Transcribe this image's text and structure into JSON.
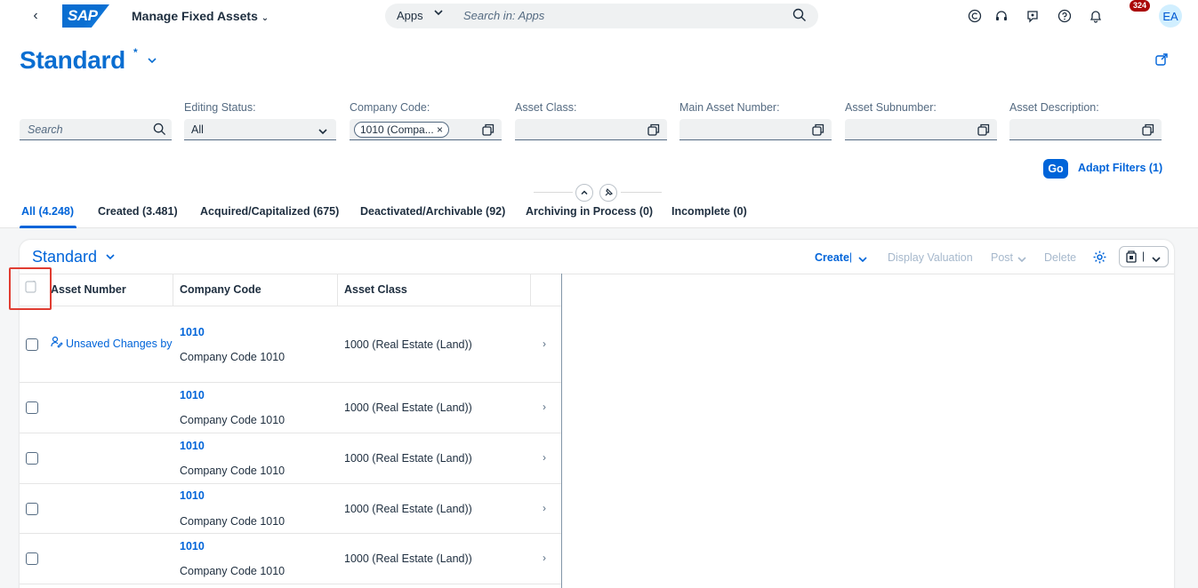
{
  "shell": {
    "logo_text": "SAP",
    "app_title": "Manage Fixed Assets",
    "search_scope": "Apps",
    "search_placeholder": "Search in: Apps",
    "notification_count": "324",
    "avatar_initials": "EA"
  },
  "header": {
    "variant_name": "Standard",
    "variant_modified_mark": "*"
  },
  "filters": {
    "search_placeholder": "Search",
    "editing_status": {
      "label": "Editing Status:",
      "value": "All"
    },
    "company_code": {
      "label": "Company Code:",
      "token": "1010 (Compa... ×"
    },
    "asset_class": {
      "label": "Asset Class:"
    },
    "main_asset_number": {
      "label": "Main Asset Number:"
    },
    "asset_subnumber": {
      "label": "Asset Subnumber:"
    },
    "asset_description": {
      "label": "Asset Description:"
    },
    "go_label": "Go",
    "adapt_label": "Adapt Filters (1)"
  },
  "tabs": [
    {
      "label": "All (4.248)"
    },
    {
      "label": "Created (3.481)"
    },
    {
      "label": "Acquired/Capitalized (675)"
    },
    {
      "label": "Deactivated/Archivable (92)"
    },
    {
      "label": "Archiving in Process (0)"
    },
    {
      "label": "Incomplete (0)"
    }
  ],
  "table": {
    "title": "Standard",
    "toolbar": {
      "create": "Create",
      "display_valuation": "Display Valuation",
      "post": "Post",
      "delete": "Delete"
    },
    "columns": [
      "Asset Number",
      "Company Code",
      "Asset Class"
    ],
    "rows": [
      {
        "asset_number": "Unsaved Changes by",
        "company_code": "1010",
        "company_name": "Company Code 1010",
        "asset_class": "1000 (Real Estate (Land))"
      },
      {
        "asset_number": "",
        "company_code": "1010",
        "company_name": "Company Code 1010",
        "asset_class": "1000 (Real Estate (Land))"
      },
      {
        "asset_number": "",
        "company_code": "1010",
        "company_name": "Company Code 1010",
        "asset_class": "1000 (Real Estate (Land))"
      },
      {
        "asset_number": "",
        "company_code": "1010",
        "company_name": "Company Code 1010",
        "asset_class": "1000 (Real Estate (Land))"
      },
      {
        "asset_number": "",
        "company_code": "1010",
        "company_name": "Company Code 1010",
        "asset_class": "1000 (Real Estate (Land))"
      }
    ]
  },
  "colors": {
    "brand_blue": "#0064d9",
    "title_blue": "#0a6ed1",
    "badge_red": "#aa0808",
    "highlight_red": "#e03c31"
  }
}
